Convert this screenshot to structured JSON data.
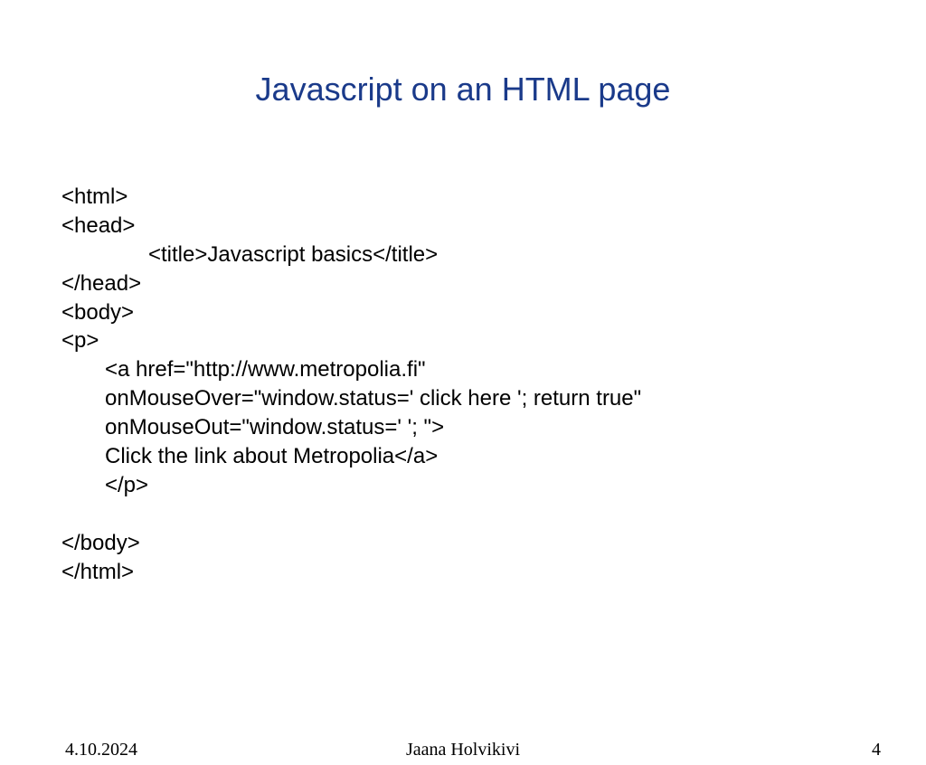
{
  "slide": {
    "title": "Javascript on an HTML page",
    "code": {
      "line1": "<html>",
      "line2": "<head>",
      "line3": "<title>Javascript basics</title>",
      "line4": "</head>",
      "line5": "<body>",
      "line6": "<p>",
      "line7": "<a href=\"http://www.metropolia.fi\"",
      "line8": "onMouseOver=\"window.status=' click here '; return true\"",
      "line9": "onMouseOut=\"window.status=' '; \">",
      "line10": "Click the link about Metropolia</a>",
      "line11": "</p>",
      "line12": "",
      "line13": "</body>",
      "line14": "</html>"
    }
  },
  "footer": {
    "date": "4.10.2024",
    "author": "Jaana Holvikivi",
    "page": "4"
  }
}
